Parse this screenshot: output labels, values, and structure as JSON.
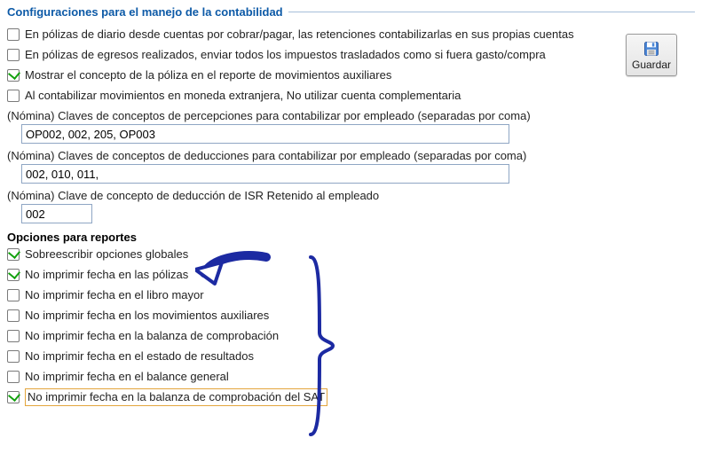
{
  "section1_title": "Configuraciones para el manejo de la contabilidad",
  "save_button_label": "Guardar",
  "config": {
    "c1": {
      "label": "En pólizas de diario desde cuentas por cobrar/pagar, las retenciones contabilizarlas en sus propias cuentas",
      "checked": false
    },
    "c2": {
      "label": "En pólizas de egresos realizados, enviar todos los impuestos trasladados como si fuera gasto/compra",
      "checked": false
    },
    "c3": {
      "label": "Mostrar el concepto de la póliza en el reporte de movimientos auxiliares",
      "checked": true
    },
    "c4": {
      "label": "Al contabilizar movimientos en moneda extranjera, No utilizar cuenta complementaria",
      "checked": false
    }
  },
  "percepciones": {
    "desc": "(Nómina) Claves de conceptos de percepciones para contabilizar por empleado (separadas por coma)",
    "value": "OP002, 002, 205, OP003"
  },
  "deducciones": {
    "desc": "(Nómina) Claves de conceptos de deducciones para contabilizar por empleado (separadas por coma)",
    "value": "002, 010, 011,"
  },
  "isr": {
    "desc": "(Nómina) Clave de concepto de deducción de ISR Retenido al empleado",
    "value": "002"
  },
  "section2_title": "Opciones para reportes",
  "reports": {
    "r1": {
      "label": "Sobreescribir opciones globales",
      "checked": true
    },
    "r2": {
      "label": "No imprimir fecha en las pólizas",
      "checked": true
    },
    "r3": {
      "label": "No imprimir fecha en el libro mayor",
      "checked": false
    },
    "r4": {
      "label": "No imprimir fecha en los movimientos auxiliares",
      "checked": false
    },
    "r5": {
      "label": "No imprimir fecha en la balanza de comprobación",
      "checked": false
    },
    "r6": {
      "label": "No imprimir fecha en el estado de resultados",
      "checked": false
    },
    "r7": {
      "label": "No imprimir fecha en el balance general",
      "checked": false
    },
    "r8": {
      "label": "No imprimir fecha en la balanza de comprobación del SAT",
      "checked": true
    }
  }
}
